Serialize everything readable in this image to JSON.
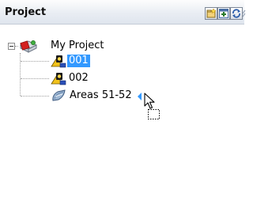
{
  "panel": {
    "title": "Project",
    "toolbar": {
      "buttons": [
        {
          "icon": "new-item-icon"
        },
        {
          "icon": "add-item-icon"
        },
        {
          "icon": "refresh-icon"
        }
      ],
      "overflow_icon": "chevron-overflow-icon"
    }
  },
  "tree": {
    "root": {
      "label": "My Project",
      "icon": "project-icon",
      "expanded": true
    },
    "children": [
      {
        "label": "001",
        "icon": "scan-station-icon",
        "selected": true
      },
      {
        "label": "002",
        "icon": "scan-station-icon",
        "selected": false
      },
      {
        "label": "Areas 51-52",
        "icon": "area-icon",
        "selected": false
      }
    ]
  },
  "drag": {
    "indicator_icon": "drop-arrow-icon",
    "cursor_icon": "drag-copy-cursor-icon"
  },
  "colors": {
    "selection": "#3399ff",
    "title_bg": "#e6ebf2"
  }
}
